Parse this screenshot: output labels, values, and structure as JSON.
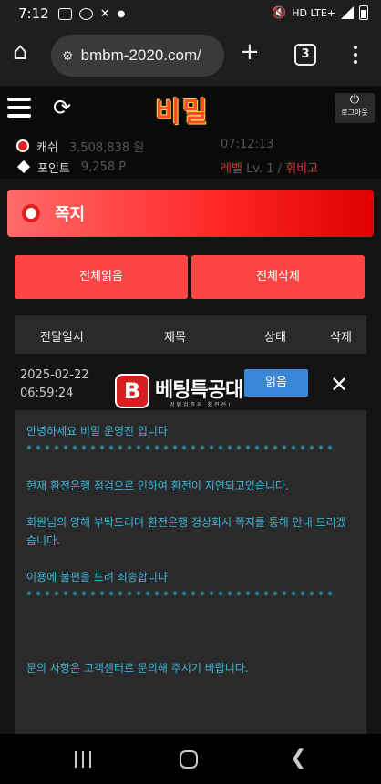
{
  "status_bar": {
    "time": "7:12",
    "network": "HD LTE+"
  },
  "browser": {
    "url": "bmbm-2020.com/",
    "tab_count": "3"
  },
  "site": {
    "logo": "비밀",
    "logout_label": "로그아웃"
  },
  "user": {
    "cash_label": "캐쉬",
    "cash_value": "3,508,838 원",
    "points_label": "포인트",
    "points_value": "9,258 P",
    "clock": "07:12:13",
    "level_label": "레벨",
    "level_value": "Lv. 1 /",
    "rank": "휘비고"
  },
  "section": {
    "title": "쪽지"
  },
  "actions": {
    "read_all": "전체읽음",
    "delete_all": "전체삭제"
  },
  "table": {
    "headers": [
      "전달일시",
      "제목",
      "상태",
      "삭제"
    ],
    "row": {
      "date": "2025-02-22",
      "time": "06:59:24",
      "status_button": "읽음"
    }
  },
  "watermark": {
    "badge": "B",
    "text": "베팅특공대",
    "subtext": "먹튀검증의 최전선!"
  },
  "message": {
    "greeting": "안녕하세요 비밀 운영진 입니다",
    "stars1": "**********************************",
    "line1": "현재 환전은행 점검으로 인하여 환전이 지연되고있습니다.",
    "line2": "회원님의 양해 부탁드리며 환전은행 정상화시 쪽지를 통해 안내 드리겠습니다.",
    "line3": "이용에 불편을 드려 죄송합니다",
    "stars2": "**********************************",
    "line4": "문의 사항은 고객센터로 문의해 주시기 바랍니다."
  }
}
